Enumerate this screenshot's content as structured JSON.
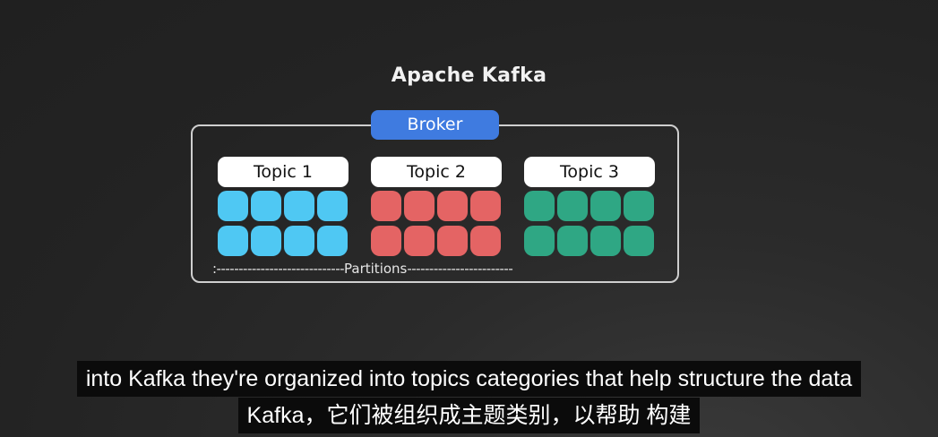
{
  "diagram": {
    "title": "Apache Kafka",
    "broker_label": "Broker",
    "topics": [
      {
        "label": "Topic 1",
        "color": "#4fc8f3"
      },
      {
        "label": "Topic 2",
        "color": "#e46464"
      },
      {
        "label": "Topic 3",
        "color": "#2fa784"
      }
    ],
    "partitions_per_topic": 8,
    "partitions_label": "Partitions"
  },
  "subtitles": {
    "line1": "into Kafka they're organized into topics categories that help structure the data",
    "line2": "Kafka，它们被组织成主题类别，以帮助 构建"
  }
}
